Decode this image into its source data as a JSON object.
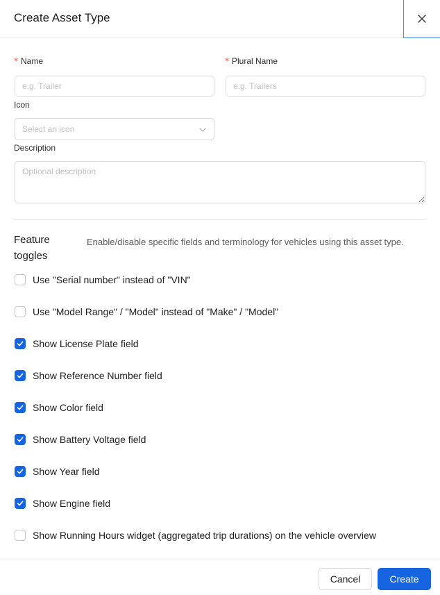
{
  "dialog": {
    "title": "Create Asset Type",
    "close_icon": "close-icon"
  },
  "form": {
    "name": {
      "label": "Name",
      "placeholder": "e.g. Trailer",
      "required_mark": "*"
    },
    "plural_name": {
      "label": "Plural Name",
      "placeholder": "e.g. Trailers",
      "required_mark": "*"
    },
    "icon": {
      "label": "Icon",
      "placeholder": "Select an icon",
      "chevron_icon": "chevron-down-icon"
    },
    "description": {
      "label": "Description",
      "placeholder": "Optional description"
    }
  },
  "feature_toggles": {
    "title": "Feature toggles",
    "description": "Enable/disable specific fields and terminology for vehicles using this asset type.",
    "items": [
      {
        "label": "Use \"Serial number\" instead of \"VIN\"",
        "checked": false
      },
      {
        "label": "Use \"Model Range\" / \"Model\" instead of \"Make\" / \"Model\"",
        "checked": false
      },
      {
        "label": "Show License Plate field",
        "checked": true
      },
      {
        "label": "Show Reference Number field",
        "checked": true
      },
      {
        "label": "Show Color field",
        "checked": true
      },
      {
        "label": "Show Battery Voltage field",
        "checked": true
      },
      {
        "label": "Show Year field",
        "checked": true
      },
      {
        "label": "Show Engine field",
        "checked": true
      },
      {
        "label": "Show Running Hours widget (aggregated trip durations) on the vehicle overview",
        "checked": false
      }
    ]
  },
  "footer": {
    "cancel_label": "Cancel",
    "create_label": "Create"
  },
  "colors": {
    "primary": "#1664e0",
    "required": "#ff4d4f",
    "border": "#d9d9d9",
    "focus_outline": "#4a90e2"
  }
}
